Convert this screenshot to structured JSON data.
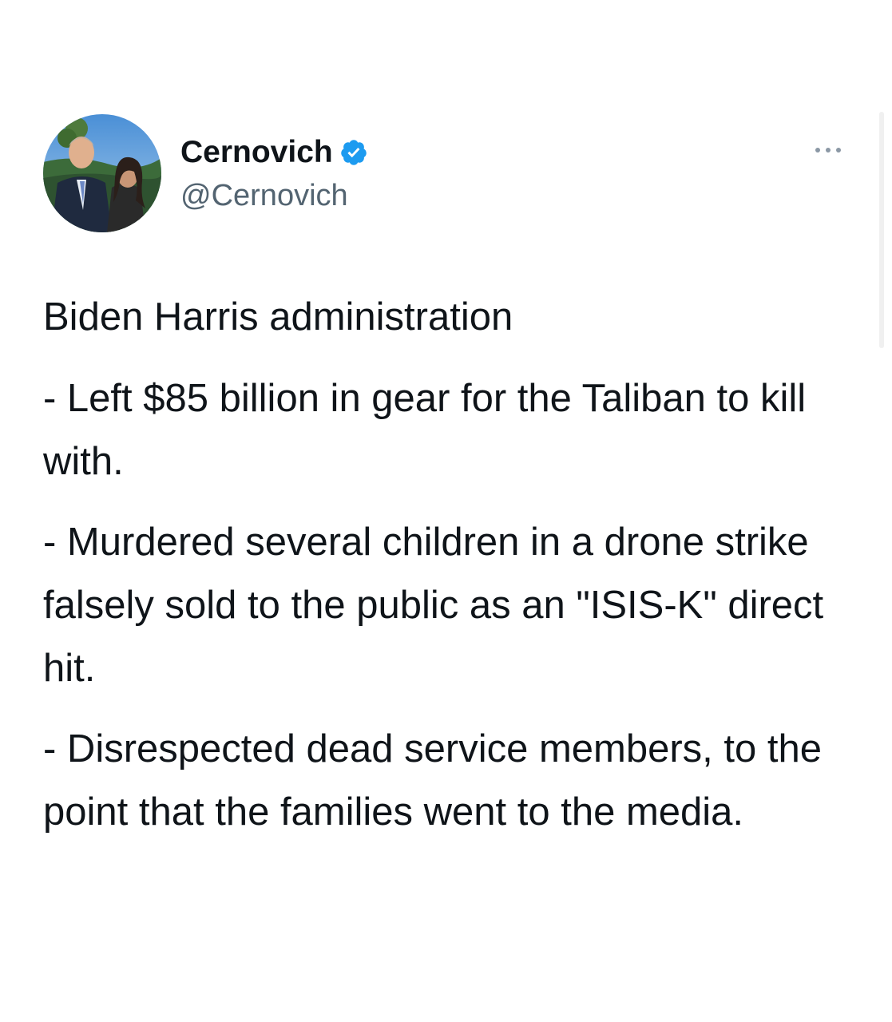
{
  "tweet": {
    "author": {
      "display_name": "Cernovich",
      "handle": "@Cernovich",
      "verified": true,
      "avatar_icon": "avatar-photo",
      "verified_icon": "verified-badge-icon"
    },
    "more_icon": "more-options-icon",
    "intro": "Biden Harris administration",
    "points": [
      "- Left $85 billion in gear for the Taliban to kill with.",
      "- Murdered several children in a drone strike falsely sold to the public as an \"ISIS-K\" direct hit.",
      "- Disrespected dead service members, to the point that the families went to the media."
    ]
  },
  "colors": {
    "text_primary": "#0f1419",
    "text_secondary": "#536471",
    "verified_blue": "#1d9bf0",
    "background": "#ffffff"
  }
}
